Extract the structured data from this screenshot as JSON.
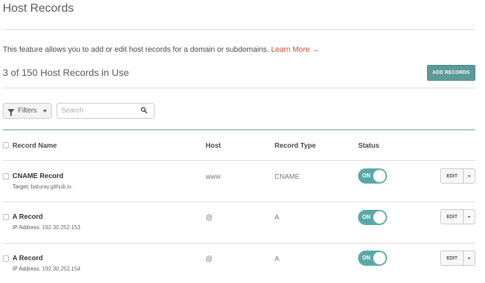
{
  "page": {
    "title": "Host Records",
    "description": "This feature allows you to add or edit host records for a domain or subdomains.",
    "learn_more": "Learn More →",
    "record_count": "3 of 150 Host Records in Use",
    "add_button": "ADD RECORDS"
  },
  "toolbar": {
    "filters_label": "Filters",
    "search_placeholder": "Search"
  },
  "table": {
    "headers": [
      "Record Name",
      "Host",
      "Record Type",
      "Status"
    ],
    "rows": [
      {
        "name": "CNAME Record",
        "sub_key": "Target:",
        "sub_value": "baturay.github.io.",
        "host": "www",
        "type": "CNAME",
        "status": "ON",
        "edit": "EDIT"
      },
      {
        "name": "A Record",
        "sub_key": "IP Address:",
        "sub_value": "192.30.252.153",
        "host": "@",
        "type": "A",
        "status": "ON",
        "edit": "EDIT"
      },
      {
        "name": "A Record",
        "sub_key": "IP Address:",
        "sub_value": "192.30.252.154",
        "host": "@",
        "type": "A",
        "status": "ON",
        "edit": "EDIT"
      }
    ]
  },
  "colors": {
    "accent": "#5c9a98",
    "toggle_on": "#5aa8a6",
    "link": "#d14a2c",
    "header_rule": "#a9c6c6"
  }
}
